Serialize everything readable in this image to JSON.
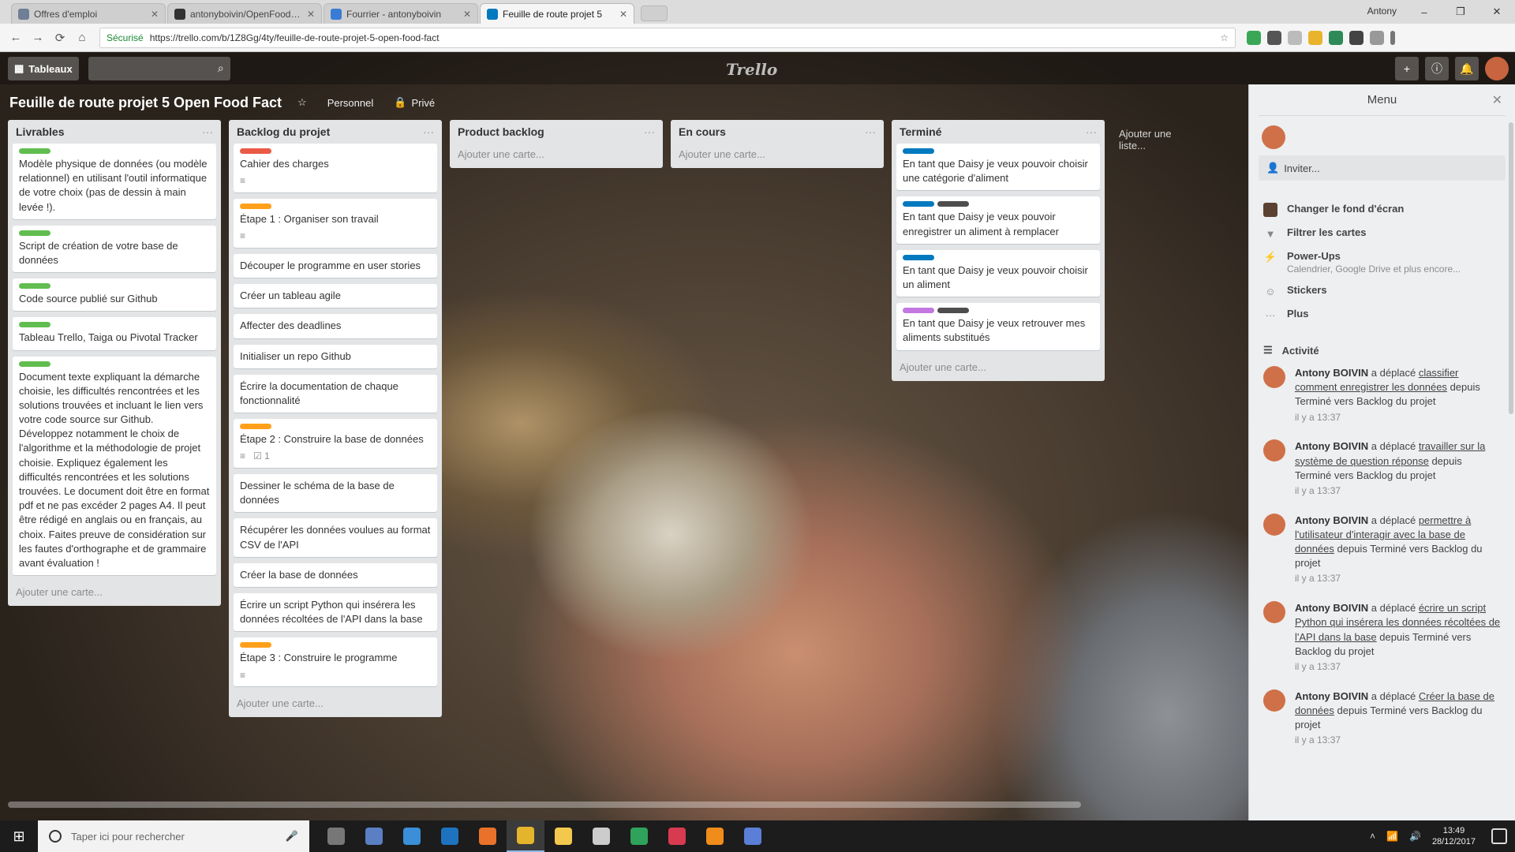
{
  "browser": {
    "tabs": [
      {
        "title": "Offres d'emploi",
        "active": false,
        "color": "#6f7f95"
      },
      {
        "title": "antonyboivin/OpenFoodFacts",
        "active": false,
        "color": "#333333"
      },
      {
        "title": "Fourrier - antonyboivin",
        "active": false,
        "color": "#3a7bd5"
      },
      {
        "title": "Feuille de route projet 5",
        "active": true,
        "color": "#0079bf"
      }
    ],
    "user": "Antony",
    "window_controls": [
      "–",
      "❐",
      "✕"
    ],
    "nav": [
      "←",
      "→",
      "⟳",
      "⌂"
    ],
    "secure_label": "Sécurisé",
    "url": "https://trello.com/b/1Z8Gg/4ty/feuille-de-route-projet-5-open-food-fact",
    "star": "☆"
  },
  "trello": {
    "boards_button": "Tableaux",
    "search_icon": "search-icon",
    "logo": "Trello",
    "header_icons": [
      "+",
      "ⓘ",
      "🔔"
    ]
  },
  "board": {
    "title": "Feuille de route projet 5 Open Food Fact",
    "star": "☆",
    "visibility": "Personnel",
    "owner": "Privé"
  },
  "lists": [
    {
      "title": "Livrables",
      "cards": [
        {
          "labels": [
            "#61bd4f"
          ],
          "text": "Modèle physique de données (ou modèle relationnel) en utilisant l'outil informatique de votre choix (pas de dessin à main levée !).",
          "badges": []
        },
        {
          "labels": [
            "#61bd4f"
          ],
          "text": "Script de création de votre base de données",
          "badges": []
        },
        {
          "labels": [
            "#61bd4f"
          ],
          "text": "Code source publié sur Github",
          "badges": []
        },
        {
          "labels": [
            "#61bd4f"
          ],
          "text": "Tableau Trello, Taiga ou Pivotal Tracker",
          "badges": []
        },
        {
          "labels": [
            "#61bd4f"
          ],
          "text": "Document texte expliquant la démarche choisie, les difficultés rencontrées et les solutions trouvées et incluant le lien vers votre code source sur Github. Développez notamment le choix de l'algorithme et la méthodologie de projet choisie. Expliquez également les difficultés rencontrées et les solutions trouvées. Le document doit être en format pdf et ne pas excéder 2 pages A4. Il peut être rédigé en anglais ou en français, au choix. Faites preuve de considération sur les fautes d'orthographe et de grammaire avant évaluation !",
          "badges": []
        }
      ],
      "add": "Ajouter une carte..."
    },
    {
      "title": "Backlog du projet",
      "cards": [
        {
          "labels": [
            "#eb5a46"
          ],
          "text": "Cahier des charges",
          "badges": [
            "≡"
          ]
        },
        {
          "labels": [
            "#ff9f1a"
          ],
          "text": "Étape 1 : Organiser son travail",
          "badges": [
            "≡"
          ]
        },
        {
          "labels": [],
          "text": "Découper le programme en user stories",
          "badges": []
        },
        {
          "labels": [],
          "text": "Créer un tableau agile",
          "badges": []
        },
        {
          "labels": [],
          "text": "Affecter des deadlines",
          "badges": []
        },
        {
          "labels": [],
          "text": "Initialiser un repo Github",
          "badges": []
        },
        {
          "labels": [],
          "text": "Écrire la documentation de chaque fonctionnalité",
          "badges": []
        },
        {
          "labels": [
            "#ff9f1a"
          ],
          "text": "Étape 2 : Construire la base de données",
          "badges": [
            "≡",
            "☑ 1"
          ]
        },
        {
          "labels": [],
          "text": "Dessiner le schéma de la base de données",
          "badges": []
        },
        {
          "labels": [],
          "text": "Récupérer les données voulues au format CSV de l'API",
          "badges": []
        },
        {
          "labels": [],
          "text": "Créer la base de données",
          "badges": []
        },
        {
          "labels": [],
          "text": "Écrire un script Python qui insérera les données récoltées de l'API dans la base",
          "badges": []
        },
        {
          "labels": [
            "#ff9f1a"
          ],
          "text": "Étape 3 : Construire le programme",
          "badges": [
            "≡"
          ]
        }
      ],
      "add": "Ajouter une carte..."
    },
    {
      "title": "Product backlog",
      "cards": [],
      "add": "Ajouter une carte..."
    },
    {
      "title": "En cours",
      "cards": [],
      "add": "Ajouter une carte..."
    },
    {
      "title": "Terminé",
      "cards": [
        {
          "labels": [
            "#0079bf"
          ],
          "text": "En tant que Daisy je veux pouvoir choisir une catégorie d'aliment",
          "badges": []
        },
        {
          "labels": [
            "#0079bf",
            "#4d4d4d"
          ],
          "text": "En tant que Daisy je veux pouvoir enregistrer un aliment à remplacer",
          "badges": []
        },
        {
          "labels": [
            "#0079bf"
          ],
          "text": "En tant que Daisy je veux pouvoir choisir un aliment",
          "badges": []
        },
        {
          "labels": [
            "#c377e0",
            "#4d4d4d"
          ],
          "text": "En tant que Daisy je veux retrouver mes aliments substitués",
          "badges": []
        }
      ],
      "add": "Ajouter une carte..."
    }
  ],
  "add_list": "Ajouter une liste...",
  "menu": {
    "title": "Menu",
    "close": "✕",
    "invite": "Inviter...",
    "items": [
      {
        "icon": "background-icon",
        "glyph": "",
        "label": "Changer le fond d'écran",
        "sub": ""
      },
      {
        "icon": "filter-icon",
        "glyph": "▼",
        "label": "Filtrer les cartes",
        "sub": ""
      },
      {
        "icon": "power-ups-icon",
        "glyph": "⚡",
        "label": "Power-Ups",
        "sub": "Calendrier, Google Drive et plus encore..."
      },
      {
        "icon": "stickers-icon",
        "glyph": "☺",
        "label": "Stickers",
        "sub": ""
      },
      {
        "icon": "more-icon",
        "glyph": "···",
        "label": "Plus",
        "sub": ""
      }
    ],
    "activity_title": "Activité",
    "activity": [
      {
        "user": "Antony BOIVIN",
        "verb": "a déplacé",
        "card": "classifier comment enregistrer les données",
        "rest": "depuis Terminé vers Backlog du projet",
        "when": "il y a 13:37"
      },
      {
        "user": "Antony BOIVIN",
        "verb": "a déplacé",
        "card": "travailler sur la système de question réponse",
        "rest": "depuis Terminé vers Backlog du projet",
        "when": "il y a 13:37"
      },
      {
        "user": "Antony BOIVIN",
        "verb": "a déplacé",
        "card": "permettre à l'utilisateur d'interagir avec la base de données",
        "rest": "depuis Terminé vers Backlog du projet",
        "when": "il y a 13:37"
      },
      {
        "user": "Antony BOIVIN",
        "verb": "a déplacé",
        "card": "écrire un script Python qui insérera les données récoltées de l'API dans la base",
        "rest": "depuis Terminé vers Backlog du projet",
        "when": "il y a 13:37"
      },
      {
        "user": "Antony BOIVIN",
        "verb": "a déplacé",
        "card": "Créer la base de données",
        "rest": "depuis Terminé vers Backlog du projet",
        "when": "il y a 13:37"
      }
    ]
  },
  "taskbar": {
    "search_placeholder": "Taper ici pour rechercher",
    "apps": [
      {
        "name": "task-view",
        "color": "#777777",
        "active": false
      },
      {
        "name": "store",
        "color": "#5a7fc4",
        "active": false
      },
      {
        "name": "ie",
        "color": "#3b8ed8",
        "active": false
      },
      {
        "name": "edge",
        "color": "#1e73be",
        "active": false
      },
      {
        "name": "firefox",
        "color": "#e8722a",
        "active": false
      },
      {
        "name": "chrome",
        "color": "#e4b42c",
        "active": true
      },
      {
        "name": "explorer",
        "color": "#f2c94c",
        "active": false
      },
      {
        "name": "mail",
        "color": "#cccccc",
        "active": false
      },
      {
        "name": "excel",
        "color": "#2fa35b",
        "active": false
      },
      {
        "name": "app-red",
        "color": "#d83b50",
        "active": false
      },
      {
        "name": "app-orange",
        "color": "#f08c1a",
        "active": false
      },
      {
        "name": "app-blue",
        "color": "#5b7fd6",
        "active": false
      }
    ],
    "time": "13:49",
    "date": "28/12/2017"
  }
}
